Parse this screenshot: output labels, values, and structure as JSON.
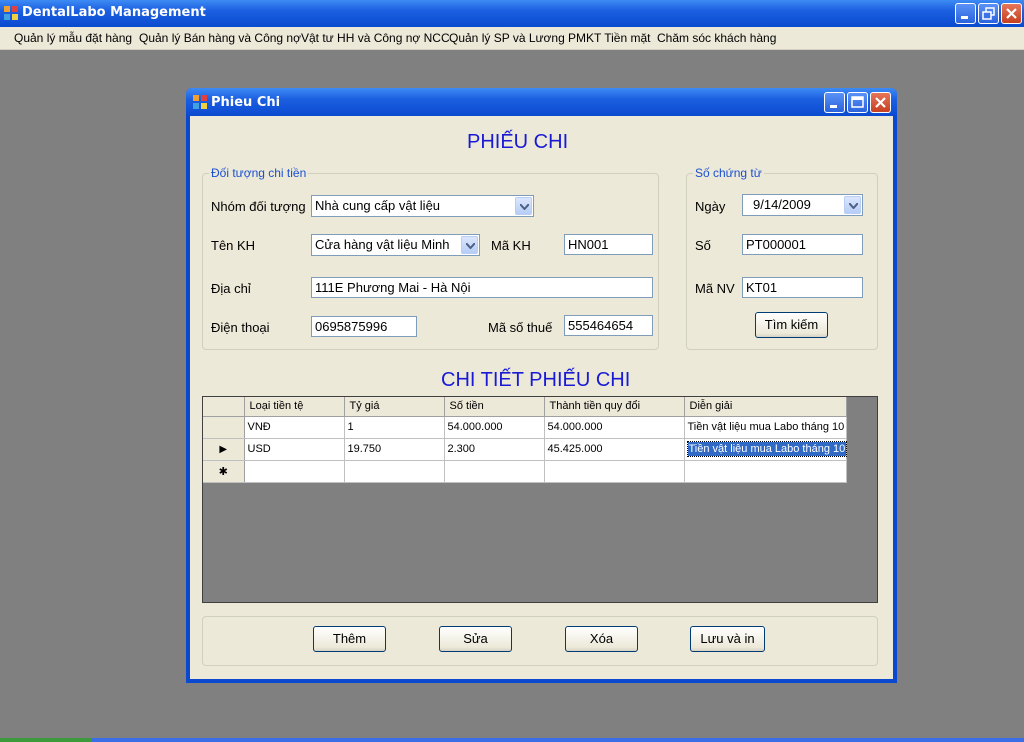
{
  "app": {
    "title": "DentalLabo Management"
  },
  "menu": [
    "Quản lý mẫu đặt hàng",
    "Quản lý Bán hàng và Công nợ",
    "Vật tư HH và Công nợ NCC",
    "Quản lý SP và Lương",
    "PMKT Tiền mặt",
    "Chăm sóc khách hàng"
  ],
  "form": {
    "title": "Phieu Chi",
    "heading": "PHIẾU CHI",
    "detail_heading": "CHI TIẾT PHIẾU CHI",
    "group_payee": {
      "legend": "Đối tượng chi tiền",
      "group_label": "Nhóm đối tượng",
      "group_value": "Nhà cung cấp vật liệu",
      "customer_label": "Tên KH",
      "customer_value": "Cửa hàng vật liệu Minh",
      "customer_code_label": "Mã KH",
      "customer_code_value": "HN001",
      "address_label": "Địa chỉ",
      "address_value": "111E Phương Mai - Hà Nội",
      "phone_label": "Điện thoại",
      "phone_value": "0695875996",
      "tax_label": "Mã số thuế",
      "tax_value": "555464654"
    },
    "group_voucher": {
      "legend": "Số chứng từ",
      "date_label": "Ngày",
      "date_value": "9/14/2009",
      "number_label": "Số",
      "number_value": "PT000001",
      "staff_label": "Mã NV",
      "staff_value": "KT01",
      "search_button": "Tìm kiếm"
    },
    "grid": {
      "columns": [
        "Loại tiền tệ",
        "Tỷ giá",
        "Số tiền",
        "Thành tiền quy đổi",
        "Diễn giải"
      ],
      "rows": [
        {
          "marker": "",
          "cells": [
            "VNĐ",
            "1",
            "54.000.000",
            "54.000.000",
            "Tiền vật liệu mua Labo tháng 10"
          ]
        },
        {
          "marker": "▶",
          "cells": [
            "USD",
            "19.750",
            "2.300",
            "45.425.000",
            "Tiền vật liệu mua Labo tháng 10"
          ]
        }
      ],
      "new_row_marker": "✱"
    },
    "buttons": {
      "add": "Thêm",
      "edit": "Sửa",
      "delete": "Xóa",
      "save_print": "Lưu và in"
    }
  },
  "colors": {
    "heading": "#1a1ad6",
    "legend": "#1a50d0",
    "title_bar": "#0a4ad0"
  }
}
